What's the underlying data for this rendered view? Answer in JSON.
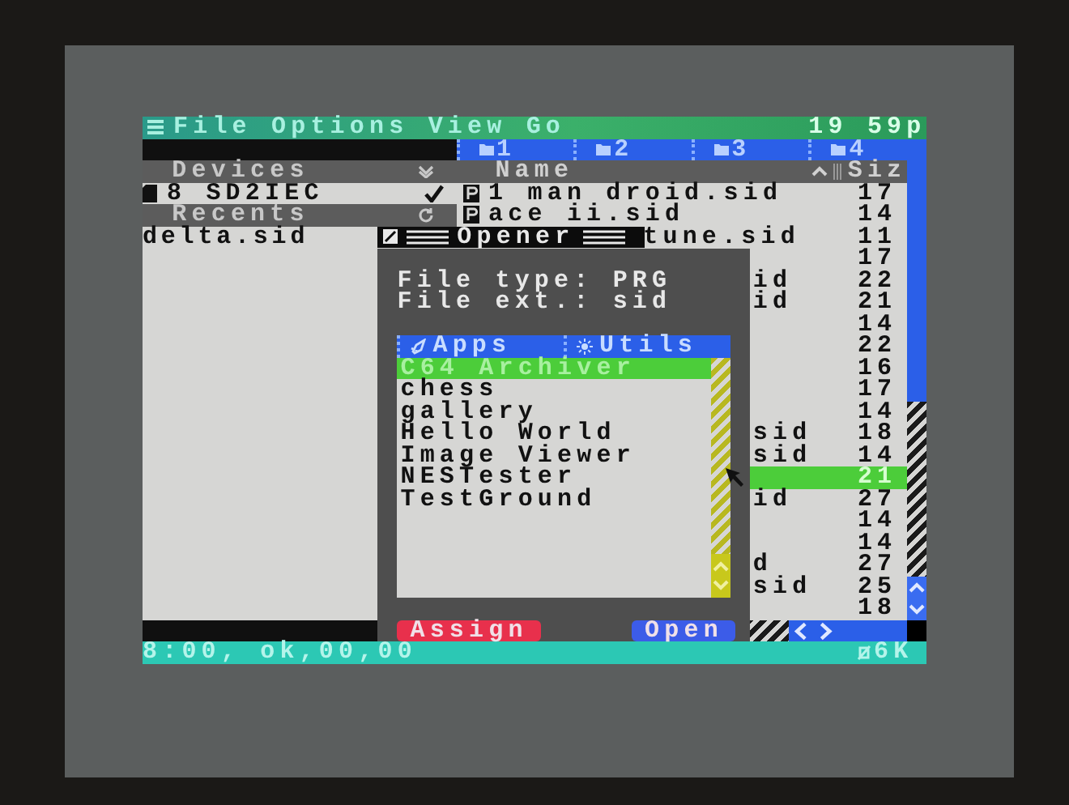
{
  "menu_bar": {
    "items": [
      "File",
      "Options",
      "View",
      "Go"
    ],
    "clock": "19 59p"
  },
  "tabs": [
    {
      "label": "1"
    },
    {
      "label": "2"
    },
    {
      "label": "3"
    },
    {
      "label": "4"
    }
  ],
  "devices": {
    "header": "Devices",
    "items": [
      {
        "label": "8 SD2IEC",
        "checked": true
      }
    ]
  },
  "recents": {
    "header": "Recents",
    "items": [
      "delta.sid"
    ]
  },
  "file_list": {
    "columns": [
      "Name",
      "Siz"
    ],
    "rows": [
      {
        "name": "1 man droid.sid",
        "size": "17",
        "icon_visible": true,
        "selected": false
      },
      {
        "name": "ace ii.sid",
        "size": "14",
        "icon_visible": true,
        "selected": false
      },
      {
        "name": "tune.sid",
        "size": "11",
        "icon_visible": false,
        "selected": false
      },
      {
        "size": "17",
        "icon_visible": false,
        "selected": false
      },
      {
        "name": "id",
        "size": "22",
        "icon_visible": false,
        "selected": false
      },
      {
        "name": "id",
        "size": "21",
        "icon_visible": false,
        "selected": false
      },
      {
        "size": "14",
        "icon_visible": false,
        "selected": false
      },
      {
        "size": "22",
        "icon_visible": false,
        "selected": false
      },
      {
        "size": "16",
        "icon_visible": false,
        "selected": false
      },
      {
        "size": "17",
        "icon_visible": false,
        "selected": false
      },
      {
        "size": "14",
        "icon_visible": false,
        "selected": false
      },
      {
        "name": "sid",
        "size": "18",
        "icon_visible": false,
        "selected": false
      },
      {
        "name": "sid",
        "size": "14",
        "icon_visible": false,
        "selected": false
      },
      {
        "size": "21",
        "icon_visible": false,
        "selected": true
      },
      {
        "name": "id",
        "size": "27",
        "icon_visible": false,
        "selected": false
      },
      {
        "size": "14",
        "icon_visible": false,
        "selected": false
      },
      {
        "size": "14",
        "icon_visible": false,
        "selected": false
      },
      {
        "name": "d",
        "size": "27",
        "icon_visible": false,
        "selected": false
      },
      {
        "name": "sid",
        "size": "25",
        "icon_visible": false,
        "selected": false
      },
      {
        "size": "18",
        "icon_visible": false,
        "selected": false
      }
    ]
  },
  "dialog": {
    "title": "Opener",
    "info": [
      "File type: PRG",
      "File ext.: sid"
    ],
    "tabs": [
      "Apps",
      "Utils"
    ],
    "items": [
      {
        "label": "C64 Archiver",
        "selected": true
      },
      {
        "label": "chess",
        "selected": false
      },
      {
        "label": "gallery",
        "selected": false
      },
      {
        "label": "Hello World",
        "selected": false
      },
      {
        "label": "Image Viewer",
        "selected": false
      },
      {
        "label": "NESTester",
        "selected": false
      },
      {
        "label": "TestGround",
        "selected": false
      }
    ],
    "buttons": [
      {
        "label": "Assign",
        "kind": "danger"
      },
      {
        "label": "Open",
        "kind": "primary"
      }
    ]
  },
  "status_bar": {
    "text": "8:00, ok,00,00",
    "memory": "6K"
  }
}
